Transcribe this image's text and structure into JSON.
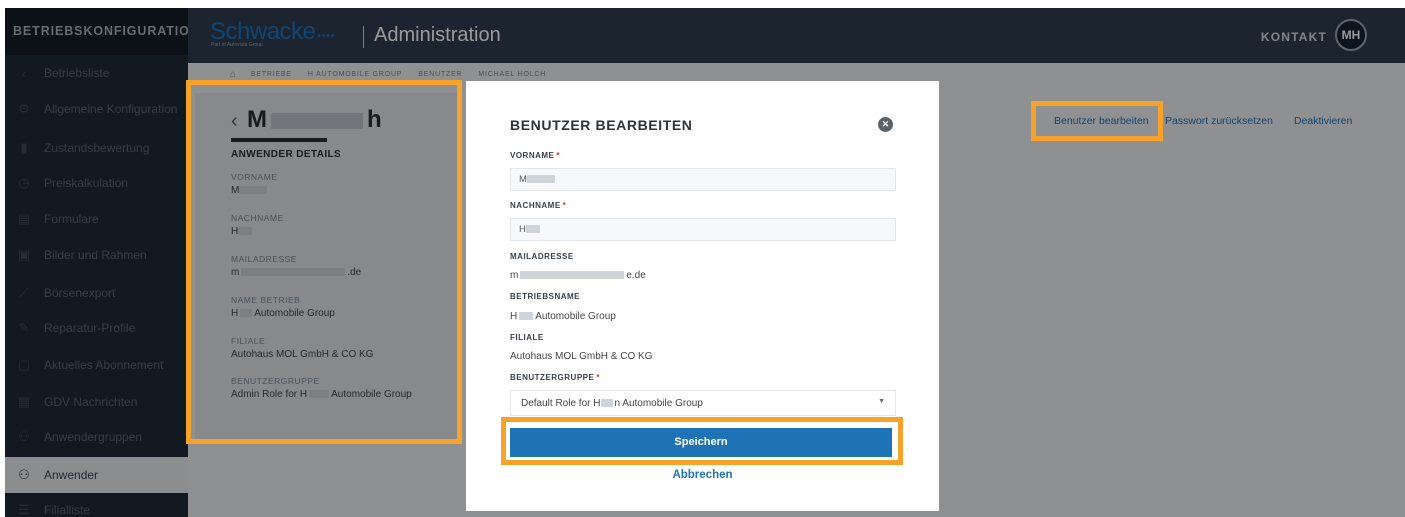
{
  "sidebar": {
    "title": "BETRIEBSKONFIGURATION",
    "items": [
      {
        "label": "Betriebsliste",
        "icon": "chevron-left-icon",
        "glyph": "‹"
      },
      {
        "label": "Allgemeine Konfiguration",
        "icon": "gear-icon",
        "glyph": "⚙"
      },
      {
        "label": "Zustandsbewertung",
        "icon": "chart-icon",
        "glyph": "▮"
      },
      {
        "label": "Preiskalkulation",
        "icon": "calculator-icon",
        "glyph": "◷"
      },
      {
        "label": "Formulare",
        "icon": "form-icon",
        "glyph": "▤"
      },
      {
        "label": "Bilder und Rahmen",
        "icon": "image-icon",
        "glyph": "▣"
      },
      {
        "label": "Börsenexport",
        "icon": "export-icon",
        "glyph": "⟋"
      },
      {
        "label": "Reparatur-Profile",
        "icon": "wrench-icon",
        "glyph": "✎"
      },
      {
        "label": "Aktuelles Abonnement",
        "icon": "subscription-icon",
        "glyph": "▢"
      },
      {
        "label": "GDV Nachrichten",
        "icon": "message-icon",
        "glyph": "▦"
      },
      {
        "label": "Anwendergruppen",
        "icon": "group-icon",
        "glyph": "⚇"
      },
      {
        "label": "Anwender",
        "icon": "users-icon",
        "glyph": "⚇"
      },
      {
        "label": "Filialliste",
        "icon": "list-icon",
        "glyph": "☰"
      }
    ]
  },
  "header": {
    "logo_text": "Schwacke",
    "logo_dots": "••••",
    "logo_sub": "Part of Autovista Group",
    "title": "Administration",
    "kontakt": "KONTAKT",
    "avatar": "MH"
  },
  "breadcrumb": [
    "BETRIEBE",
    "H AUTOMOBILE GROUP",
    "BENUTZER",
    "MICHAEL HOLCH"
  ],
  "details": {
    "name_start": "M",
    "name_end": "h",
    "section": "ANWENDER DETAILS",
    "fields": [
      {
        "label": "VORNAME",
        "value": "M"
      },
      {
        "label": "NACHNAME",
        "value": "H"
      },
      {
        "label": "MAILADRESSE",
        "value_start": "m",
        "value_end": ".de"
      },
      {
        "label": "NAME BETRIEB",
        "value_start": "H",
        "value_end": "Automobile Group"
      },
      {
        "label": "FILIALE",
        "value": "Autohaus MOL GmbH & CO KG"
      },
      {
        "label": "BENUTZERGRUPPE",
        "value_start": "Admin Role for H",
        "value_end": "Automobile Group"
      }
    ]
  },
  "actions": {
    "edit": "Benutzer bearbeiten",
    "reset": "Passwort zurücksetzen",
    "deactivate": "Deaktivieren"
  },
  "modal": {
    "title": "BENUTZER BEARBEITEN",
    "vorname_label": "VORNAME",
    "vorname_value": "M",
    "nachname_label": "NACHNAME",
    "nachname_value": "H",
    "required_mark": "*",
    "mail_label": "MAILADRESSE",
    "mail_start": "m",
    "mail_end": "e.de",
    "betrieb_label": "BETRIEBSNAME",
    "betrieb_start": "H",
    "betrieb_end": "Automobile Group",
    "filiale_label": "FILIALE",
    "filiale_value": "Autohaus MOL GmbH & CO KG",
    "gruppe_label": "BENUTZERGRUPPE",
    "gruppe_start": "Default Role for H",
    "gruppe_end": "n Automobile Group",
    "save": "Speichern",
    "cancel": "Abbrechen"
  },
  "colors": {
    "accent": "#1e73be",
    "highlight": "#f7a32b",
    "sidebar_bg": "#1f2b38",
    "header_bg": "#2f3f4f"
  }
}
